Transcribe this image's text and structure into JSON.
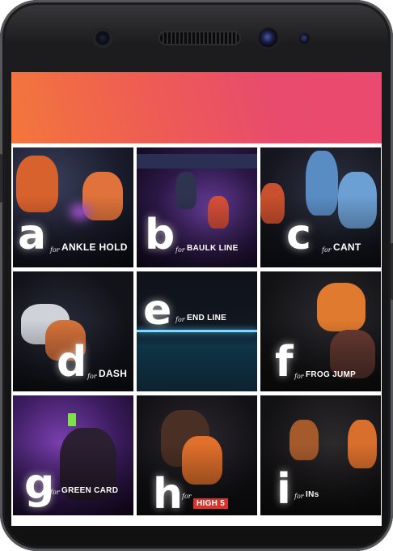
{
  "tiles": [
    {
      "letter": "a",
      "for": "for",
      "term": "ANKLE HOLD"
    },
    {
      "letter": "b",
      "for": "for",
      "term": "BAULK LINE"
    },
    {
      "letter": "c",
      "for": "for",
      "term": "CANT"
    },
    {
      "letter": "d",
      "for": "for",
      "term": "DASH"
    },
    {
      "letter": "e",
      "for": "for",
      "term": "END LINE"
    },
    {
      "letter": "f",
      "for": "for",
      "term": "FROG JUMP"
    },
    {
      "letter": "g",
      "for": "for",
      "term": "GREEN CARD"
    },
    {
      "letter": "h",
      "for": "for",
      "term": "HIGH 5"
    },
    {
      "letter": "i",
      "for": "for",
      "term": "INs"
    }
  ],
  "colors": {
    "banner_start": "#f3773b",
    "banner_end": "#e84b6d",
    "high5_badge": "#d9342b"
  },
  "icons": [
    "front-camera-icon",
    "earpiece-speaker-icon",
    "rear-camera-icon",
    "proximity-sensor-icon"
  ]
}
